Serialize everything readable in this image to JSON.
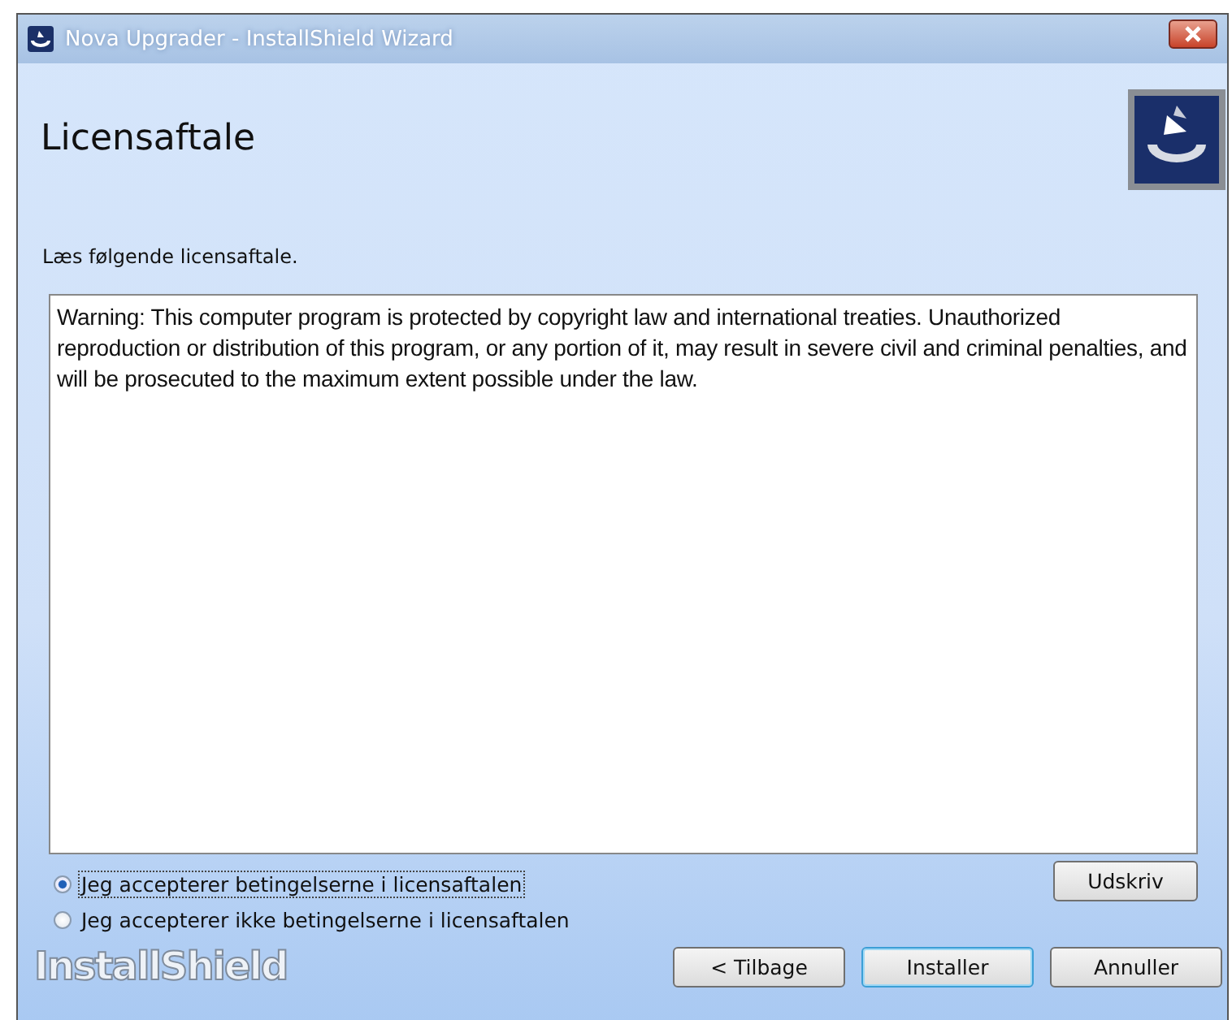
{
  "window": {
    "title": "Nova Upgrader - InstallShield Wizard"
  },
  "header": {
    "title": "Licensaftale",
    "subtitle": "Læs følgende licensaftale."
  },
  "license_text": "Warning: This computer program is protected by copyright law and international treaties. Unauthorized reproduction or distribution of this program, or any portion of it, may result in severe civil and criminal penalties, and will be prosecuted to the maximum extent possible under the law.",
  "options": [
    {
      "label": "Jeg accepterer betingelserne i licensaftalen",
      "selected": true
    },
    {
      "label": "Jeg accepterer ikke betingelserne i licensaftalen",
      "selected": false
    }
  ],
  "print_button": "Udskriv",
  "brand": "InstallShield",
  "buttons": [
    {
      "label": "< Tilbage",
      "default": false
    },
    {
      "label": "Installer",
      "default": true
    },
    {
      "label": "Annuller",
      "default": false
    }
  ]
}
